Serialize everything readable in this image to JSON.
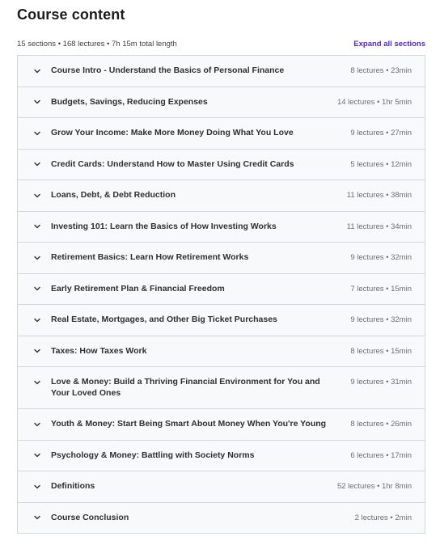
{
  "header": {
    "title": "Course content",
    "summary": "15 sections • 168 lectures • 7h 15m total length",
    "expand_all_label": "Expand all sections"
  },
  "colors": {
    "accent": "#5624d0",
    "section_bg": "#f7f9fa",
    "border": "#d1d7dc"
  },
  "sections": [
    {
      "title": "Course Intro - Understand the Basics of Personal Finance",
      "info": "8 lectures • 23min",
      "icon": "chevron-down-icon"
    },
    {
      "title": "Budgets, Savings, Reducing Expenses",
      "info": "14 lectures • 1hr 5min",
      "icon": "chevron-down-icon"
    },
    {
      "title": "Grow Your Income: Make More Money Doing What You Love",
      "info": "9 lectures • 27min",
      "icon": "chevron-down-icon"
    },
    {
      "title": "Credit Cards: Understand How to Master Using Credit Cards",
      "info": "5 lectures • 12min",
      "icon": "chevron-down-icon"
    },
    {
      "title": "Loans, Debt, & Debt Reduction",
      "info": "11 lectures • 38min",
      "icon": "chevron-down-icon"
    },
    {
      "title": "Investing 101: Learn the Basics of How Investing Works",
      "info": "11 lectures • 34min",
      "icon": "chevron-down-icon"
    },
    {
      "title": "Retirement Basics: Learn How Retirement Works",
      "info": "9 lectures • 32min",
      "icon": "chevron-down-icon"
    },
    {
      "title": "Early Retirement Plan & Financial Freedom",
      "info": "7 lectures • 15min",
      "icon": "chevron-down-icon"
    },
    {
      "title": "Real Estate, Mortgages, and Other Big Ticket Purchases",
      "info": "9 lectures • 32min",
      "icon": "chevron-down-icon"
    },
    {
      "title": "Taxes: How Taxes Work",
      "info": "8 lectures • 15min",
      "icon": "chevron-down-icon"
    },
    {
      "title": "Love & Money: Build a Thriving Financial Environment for You and Your Loved Ones",
      "info": "9 lectures • 31min",
      "icon": "chevron-down-icon"
    },
    {
      "title": "Youth & Money: Start Being Smart About Money When You're Young",
      "info": "8 lectures • 26min",
      "icon": "chevron-down-icon"
    },
    {
      "title": "Psychology & Money: Battling with Society Norms",
      "info": "6 lectures • 17min",
      "icon": "chevron-down-icon"
    },
    {
      "title": "Definitions",
      "info": "52 lectures • 1hr 8min",
      "icon": "chevron-down-icon"
    },
    {
      "title": "Course Conclusion",
      "info": "2 lectures • 2min",
      "icon": "chevron-down-icon"
    }
  ]
}
